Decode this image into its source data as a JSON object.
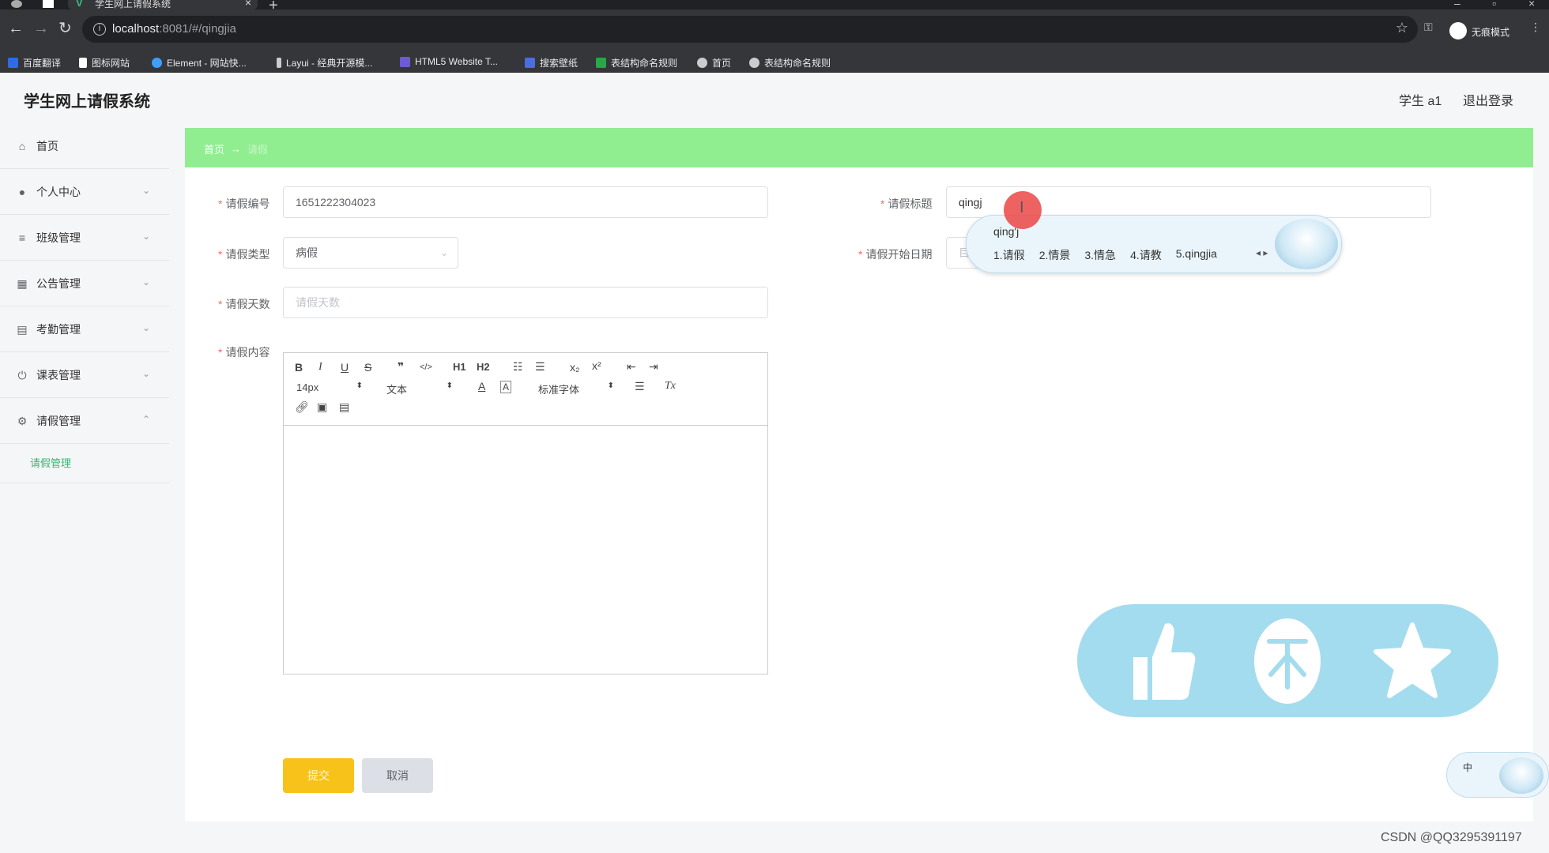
{
  "browser": {
    "tab_title": "学生网上请假系统",
    "url_host": "localhost",
    "url_rest": ":8081/#/qingjia",
    "incognito_label": "无痕模式",
    "bookmarks": [
      {
        "label": "百度翻译",
        "color": "#2b6de5"
      },
      {
        "label": "图标网站",
        "color": "#ffffff"
      },
      {
        "label": "Element - 网站快...",
        "color": "#409eff"
      },
      {
        "label": "Layui - 经典开源模...",
        "color": "#cccccc"
      },
      {
        "label": "HTML5 Website T...",
        "color": "#6b5bd6"
      },
      {
        "label": "搜索壁纸",
        "color": "#4a6ee0"
      },
      {
        "label": "表结构命名规则",
        "color": "#27a844"
      },
      {
        "label": "首页",
        "color": "#cccccc"
      },
      {
        "label": "表结构命名规则",
        "color": "#cccccc"
      }
    ]
  },
  "app": {
    "title": "学生网上请假系统",
    "user": "学生 a1",
    "logout": "退出登录"
  },
  "sidebar": {
    "items": [
      {
        "label": "首页",
        "icon": "home-icon"
      },
      {
        "label": "个人中心",
        "icon": "user-icon"
      },
      {
        "label": "班级管理",
        "icon": "list-icon"
      },
      {
        "label": "公告管理",
        "icon": "chart-icon"
      },
      {
        "label": "考勤管理",
        "icon": "clipboard-icon"
      },
      {
        "label": "课表管理",
        "icon": "power-icon"
      },
      {
        "label": "请假管理",
        "icon": "gear-icon"
      }
    ],
    "sub_item": "请假管理"
  },
  "breadcrumb": {
    "home": "首页",
    "separator": "→",
    "current": "请假"
  },
  "form": {
    "no_label": "请假编号",
    "no_value": "1651222304023",
    "title_label": "请假标题",
    "title_value": "qingj",
    "type_label": "请假类型",
    "type_value": "病假",
    "start_label": "请假开始日期",
    "start_icon_glyph": "目",
    "days_label": "请假天数",
    "days_placeholder": "请假天数",
    "content_label": "请假内容",
    "required_mark": "*",
    "submit": "提交",
    "cancel": "取消"
  },
  "editor": {
    "font_size": "14px",
    "block_type": "文本",
    "font_family": "标准字体",
    "buttons": {
      "bold": "B",
      "italic": "I",
      "underline": "U",
      "strike": "S",
      "quote": "❞",
      "code": "</>",
      "h1": "H1",
      "h2": "H2",
      "ol": "☷",
      "ul": "☰",
      "sub": "x₂",
      "sup": "x²",
      "outdent": "⇤",
      "indent": "⇥",
      "color": "A",
      "bg": "A",
      "align": "☰",
      "clean": "Tx"
    }
  },
  "ime": {
    "composition": "qing'j",
    "candidates": [
      "1.请假",
      "2.情景",
      "3.情急",
      "4.请教",
      "5.qingjia"
    ],
    "mini_label": "中"
  },
  "watermark": "CSDN @QQ3295391197",
  "colors": {
    "breadcrumb_bg": "#90ee90",
    "submit_bg": "#f7c31b",
    "active_sub": "#3cb371",
    "fab_bg": "#a3dcee"
  }
}
